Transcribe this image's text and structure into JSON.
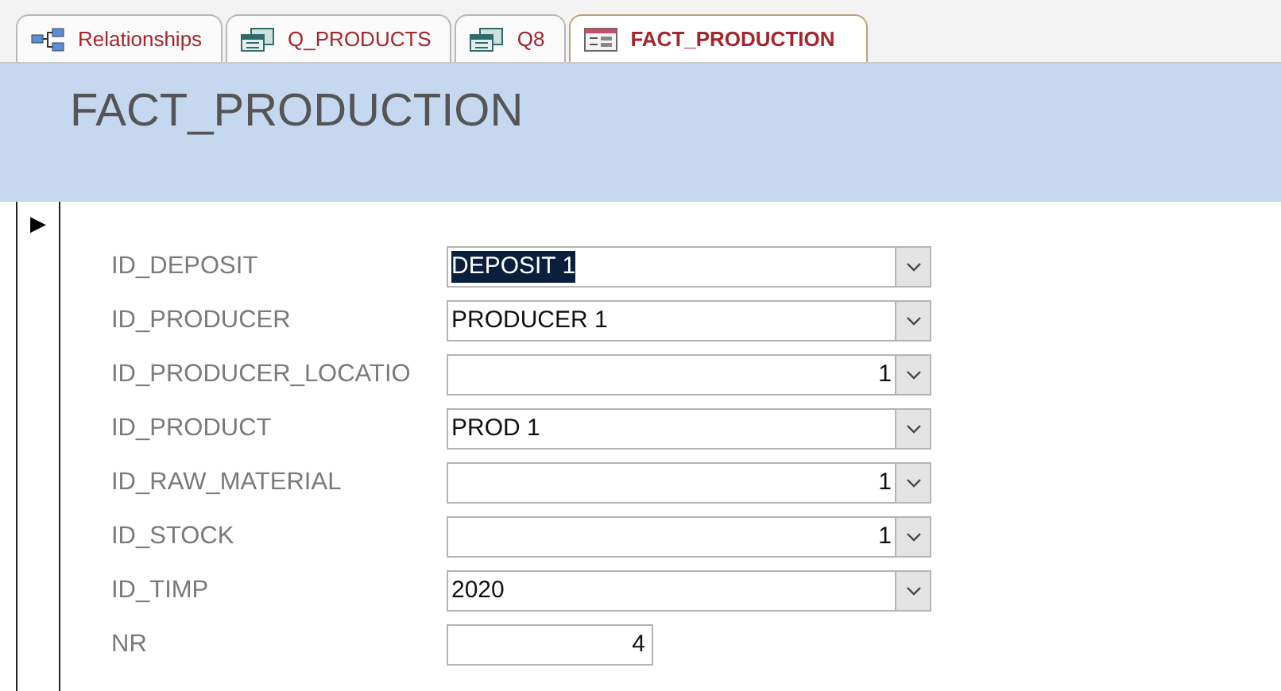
{
  "tabs": [
    {
      "label": "Relationships",
      "kind": "relationships",
      "selected": false
    },
    {
      "label": "Q_PRODUCTS",
      "kind": "query",
      "selected": false
    },
    {
      "label": "Q8",
      "kind": "query",
      "selected": false
    },
    {
      "label": "FACT_PRODUCTION",
      "kind": "form",
      "selected": true
    }
  ],
  "form": {
    "title": "FACT_PRODUCTION",
    "record_selector": "▶",
    "fields": [
      {
        "label": "ID_DEPOSIT",
        "kind": "combo",
        "value": "DEPOSIT 1",
        "numeric": false,
        "selected": true
      },
      {
        "label": "ID_PRODUCER",
        "kind": "combo",
        "value": "PRODUCER 1",
        "numeric": false,
        "selected": false
      },
      {
        "label": "ID_PRODUCER_LOCATIO",
        "kind": "combo",
        "value": "1",
        "numeric": true,
        "selected": false
      },
      {
        "label": "ID_PRODUCT",
        "kind": "combo",
        "value": "PROD 1",
        "numeric": false,
        "selected": false
      },
      {
        "label": "ID_RAW_MATERIAL",
        "kind": "combo",
        "value": "1",
        "numeric": true,
        "selected": false
      },
      {
        "label": "ID_STOCK",
        "kind": "combo",
        "value": "1",
        "numeric": true,
        "selected": false
      },
      {
        "label": "ID_TIMP",
        "kind": "combo",
        "value": "2020",
        "numeric": false,
        "selected": false
      },
      {
        "label": "NR",
        "kind": "text",
        "value": "4",
        "numeric": true,
        "selected": false
      }
    ]
  }
}
